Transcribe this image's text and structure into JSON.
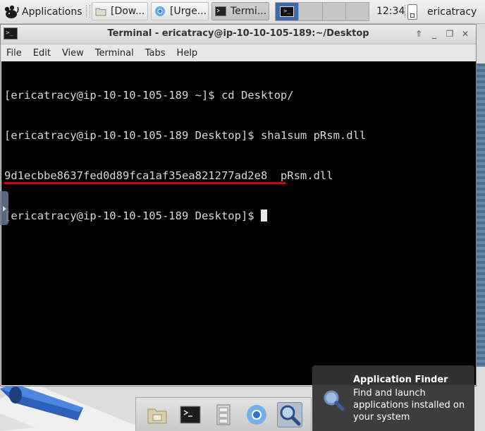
{
  "top_panel": {
    "applications_label": "Applications",
    "tasks": [
      {
        "label": "[Dow...",
        "icon": "folder-icon"
      },
      {
        "label": "[Urge...",
        "icon": "chromium-icon"
      },
      {
        "label": "Termi...",
        "icon": "terminal-icon"
      }
    ],
    "workspaces": [
      "1",
      "2",
      "3",
      "4"
    ],
    "clock": "12:34",
    "user": "ericatracy"
  },
  "window": {
    "title": "Terminal - ericatracy@ip-10-10-105-189:~/Desktop",
    "menu": [
      "File",
      "Edit",
      "View",
      "Terminal",
      "Tabs",
      "Help"
    ],
    "terminal_lines": [
      "[ericatracy@ip-10-10-105-189 ~]$ cd Desktop/",
      "[ericatracy@ip-10-10-105-189 Desktop]$ sha1sum pRsm.dll",
      "9d1ecbbe8637fed0d89fca1af35ea821277ad2e8  pRsm.dll",
      "[ericatracy@ip-10-10-105-189 Desktop]$ "
    ],
    "highlight_color": "#d00000"
  },
  "dock": {
    "items": [
      "file-manager-icon",
      "terminal-icon",
      "file-cabinet-icon",
      "chromium-icon",
      "app-finder-icon"
    ]
  },
  "notification": {
    "title": "Application Finder",
    "body": "Find and launch applications installed on your system"
  }
}
